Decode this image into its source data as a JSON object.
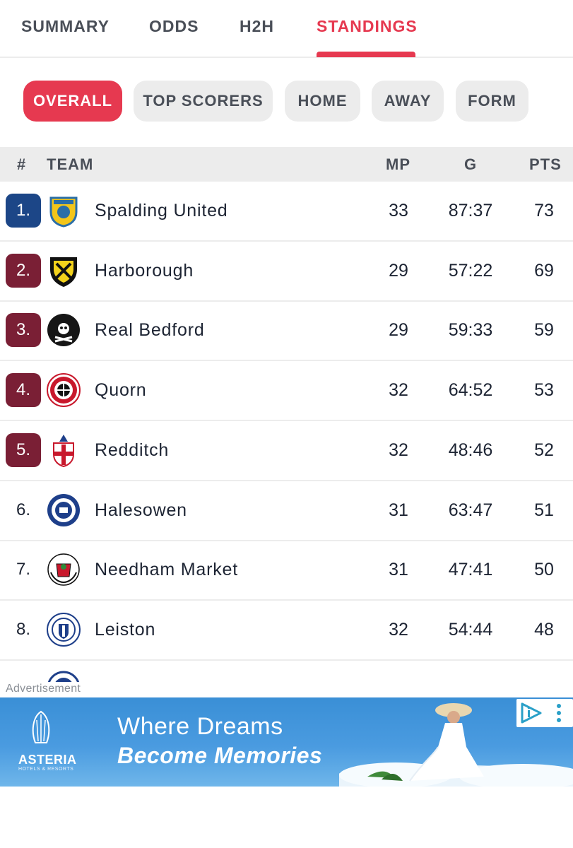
{
  "tabs": [
    {
      "label": "SUMMARY"
    },
    {
      "label": "ODDS"
    },
    {
      "label": "H2H"
    },
    {
      "label": "STANDINGS"
    }
  ],
  "filters": [
    {
      "label": "OVERALL"
    },
    {
      "label": "TOP SCORERS"
    },
    {
      "label": "HOME"
    },
    {
      "label": "AWAY"
    },
    {
      "label": "FORM"
    }
  ],
  "table": {
    "headers": {
      "rank": "#",
      "team": "TEAM",
      "mp": "MP",
      "g": "G",
      "pts": "PTS"
    },
    "rows": [
      {
        "rank": "1.",
        "team": "Spalding United",
        "mp": "33",
        "g": "87:37",
        "pts": "73",
        "highlight": "#1c4687",
        "logo": "spalding-crest-icon"
      },
      {
        "rank": "2.",
        "team": "Harborough",
        "mp": "29",
        "g": "57:22",
        "pts": "69",
        "highlight": "#7a1f35",
        "logo": "harborough-crest-icon"
      },
      {
        "rank": "3.",
        "team": "Real Bedford",
        "mp": "29",
        "g": "59:33",
        "pts": "59",
        "highlight": "#7a1f35",
        "logo": "real-bedford-crest-icon"
      },
      {
        "rank": "4.",
        "team": "Quorn",
        "mp": "32",
        "g": "64:52",
        "pts": "53",
        "highlight": "#7a1f35",
        "logo": "quorn-crest-icon"
      },
      {
        "rank": "5.",
        "team": "Redditch",
        "mp": "32",
        "g": "48:46",
        "pts": "52",
        "highlight": "#7a1f35",
        "logo": "redditch-crest-icon"
      },
      {
        "rank": "6.",
        "team": "Halesowen",
        "mp": "31",
        "g": "63:47",
        "pts": "51",
        "highlight": "",
        "logo": "halesowen-crest-icon"
      },
      {
        "rank": "7.",
        "team": "Needham Market",
        "mp": "31",
        "g": "47:41",
        "pts": "50",
        "highlight": "",
        "logo": "needham-market-crest-icon"
      },
      {
        "rank": "8.",
        "team": "Leiston",
        "mp": "32",
        "g": "54:44",
        "pts": "48",
        "highlight": "",
        "logo": "leiston-crest-icon"
      }
    ]
  },
  "ad": {
    "label": "Advertisement",
    "headline_line1": "Where Dreams",
    "headline_line2": "Become Memories",
    "brand": "ASTERIA",
    "brand_sub": "HOTELS & RESORTS"
  },
  "colors": {
    "accent": "#e63950",
    "promotion": "#1c4687",
    "playoff": "#7a1f35",
    "chip_bg": "#ececec"
  }
}
